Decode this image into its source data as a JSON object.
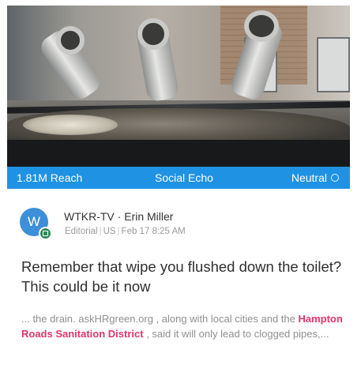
{
  "stats": {
    "reach": "1.81M Reach",
    "channel": "Social Echo",
    "sentiment": "Neutral"
  },
  "author": {
    "avatar_letter": "W",
    "source": "WTKR-TV",
    "dot": "·",
    "name": "Erin Miller",
    "type": "Editorial",
    "country": "US",
    "date": "Feb 17",
    "time": "8:25 AM"
  },
  "headline": "Remember that wipe you flushed down the toilet? This could be it now",
  "snippet": {
    "before": "... the drain. askHRgreen.org , along with local cities and the ",
    "highlight": "Hampton Roads Sanitation District",
    "after": " , said it will only lead to clogged pipes,..."
  },
  "colors": {
    "bar": "#1f92e3",
    "highlight": "#e0356a",
    "avatar": "#3c8fd8"
  }
}
